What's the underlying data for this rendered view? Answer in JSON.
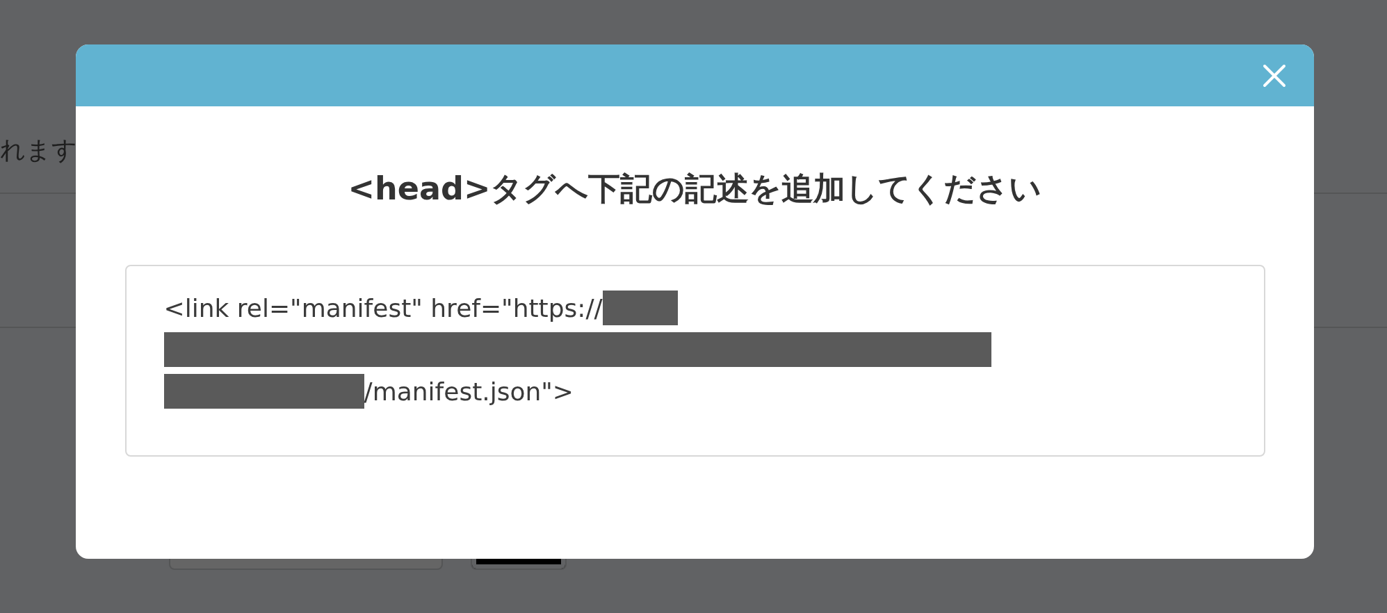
{
  "background_page": {
    "partial_text": "れます"
  },
  "dialog": {
    "title": "<head>タグへ下記の記述を追加してください",
    "code_lines": [
      [
        {
          "kind": "text",
          "text": "<link rel=\"manifest\" href=\"https://"
        },
        {
          "kind": "redacted"
        }
      ],
      [
        {
          "kind": "redacted"
        }
      ],
      [
        {
          "kind": "redacted"
        },
        {
          "kind": "text",
          "text": "/manifest.json\">"
        }
      ]
    ]
  }
}
